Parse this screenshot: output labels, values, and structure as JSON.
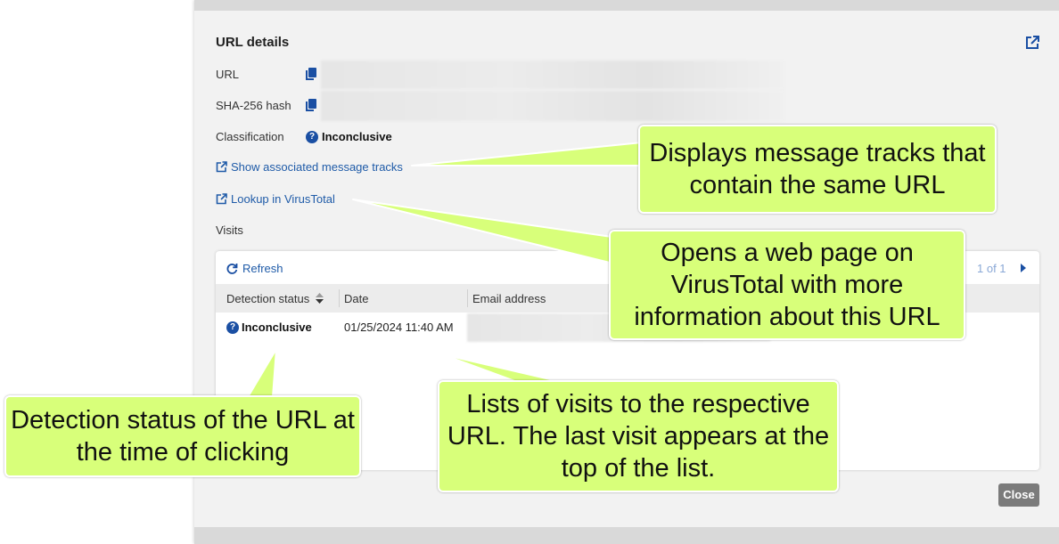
{
  "modal": {
    "title": "URL details",
    "url_label": "URL",
    "sha_label": "SHA-256 hash",
    "classification_label": "Classification",
    "classification_value": "Inconclusive",
    "classification_icon": "question-circle-icon",
    "link_message_tracks": "Show associated message tracks",
    "link_virustotal": "Lookup in VirusTotal",
    "visits_label": "Visits",
    "close_label": "Close",
    "accent_color": "#1a4fa3"
  },
  "visits": {
    "refresh_label": "Refresh",
    "pagination": "1 of 1",
    "columns": [
      "Detection status",
      "Date",
      "Email address"
    ],
    "rows": [
      {
        "status": "Inconclusive",
        "date": "01/25/2024 11:40 AM"
      }
    ]
  },
  "callouts": {
    "message_tracks": "Displays message tracks that contain the same URL",
    "virustotal": "Opens a web page on VirusTotal with more information about this URL",
    "detection": "Detection status of the URL at the time of clicking",
    "visits": "Lists of visits to the respective URL. The last visit appears at the top of the list.",
    "fill_color": "#d8ff7a"
  }
}
